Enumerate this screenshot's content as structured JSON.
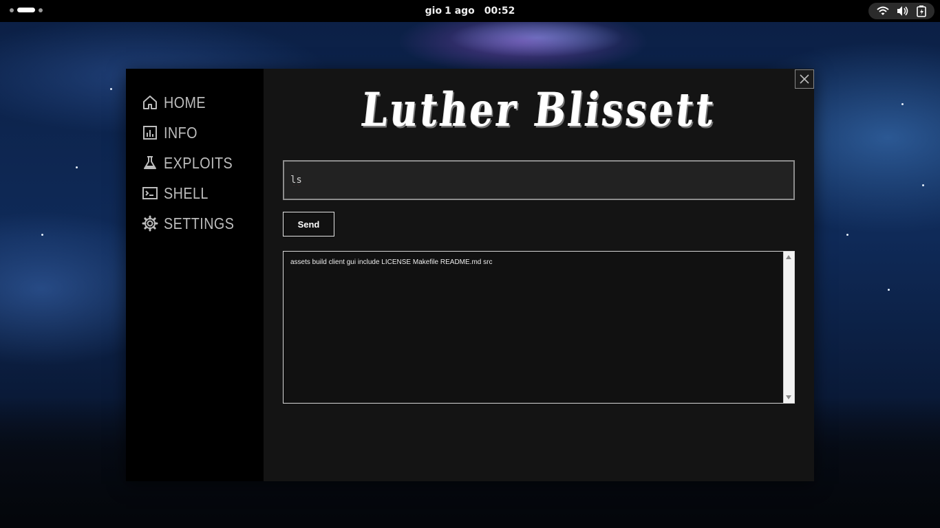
{
  "topbar": {
    "day": "gio",
    "date": "1 ago",
    "time": "00:52",
    "tray_icons": [
      "wifi-icon",
      "volume-icon",
      "battery-icon"
    ]
  },
  "app": {
    "logo_text": "Luther Blissett",
    "nav": [
      {
        "label": "HOME",
        "icon": "home-icon"
      },
      {
        "label": "INFO",
        "icon": "chart-icon"
      },
      {
        "label": "EXPLOITS",
        "icon": "flask-icon"
      },
      {
        "label": "SHELL",
        "icon": "terminal-icon"
      },
      {
        "label": "SETTINGS",
        "icon": "gear-icon"
      }
    ],
    "command_input": {
      "value": "ls"
    },
    "send_label": "Send",
    "output": "assets build client gui include LICENSE Makefile README.md src"
  },
  "colors": {
    "sidebar_bg": "#000000",
    "content_bg": "#141414",
    "nav_text": "#bdbdbd",
    "accent_border": "#8d8d8d"
  }
}
